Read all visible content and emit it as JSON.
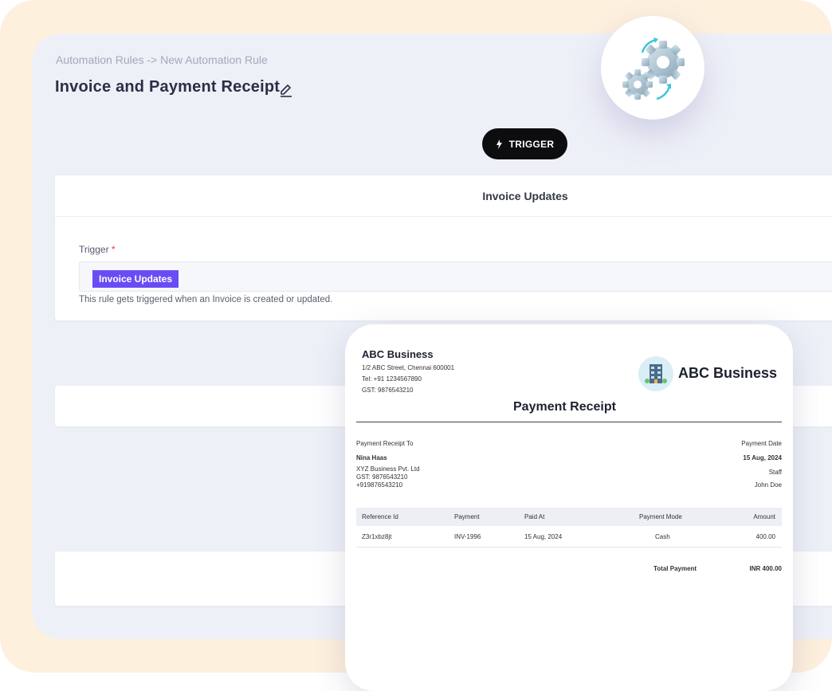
{
  "breadcrumb": "Automation Rules -> New Automation Rule",
  "page_title": "Invoice and Payment Receipt",
  "trigger_button": {
    "label": "TRIGGER"
  },
  "trigger_card": {
    "header": "Invoice Updates",
    "field_label": "Trigger",
    "required_mark": "*",
    "selected_tag": "Invoice Updates",
    "help_text": "This rule gets triggered when an Invoice is created or updated."
  },
  "receipt": {
    "company_name": "ABC Business",
    "address": "1/2 ABC Street, Chennai 600001",
    "tel": "Tel: +91 1234567890",
    "gst": "GST: 9876543210",
    "logo_text": "ABC Business",
    "title": "Payment Receipt",
    "to_label": "Payment Receipt To",
    "customer_name": "Nina Haas",
    "customer_company": "XYZ Business Pvt. Ltd",
    "customer_gst": "GST: 9876543210",
    "customer_phone": "+919876543210",
    "date_label": "Payment Date",
    "date_value": "15 Aug, 2024",
    "staff_label": "Staff",
    "staff_value": "John Doe",
    "table_headers": [
      "Reference Id",
      "Payment",
      "Paid At",
      "Payment Mode",
      "Amount"
    ],
    "rows": [
      [
        "Z3r1xbz8jt",
        "INV-1996",
        "15 Aug, 2024",
        "Cash",
        "400.00"
      ]
    ],
    "total_label": "Total Payment",
    "total_value": "INR 400.00"
  },
  "colors": {
    "accent": "#6a4cf5",
    "button_bg": "#0d0d0f",
    "outer_bg": "#fdf0dd",
    "panel_bg": "#eef0f8"
  }
}
